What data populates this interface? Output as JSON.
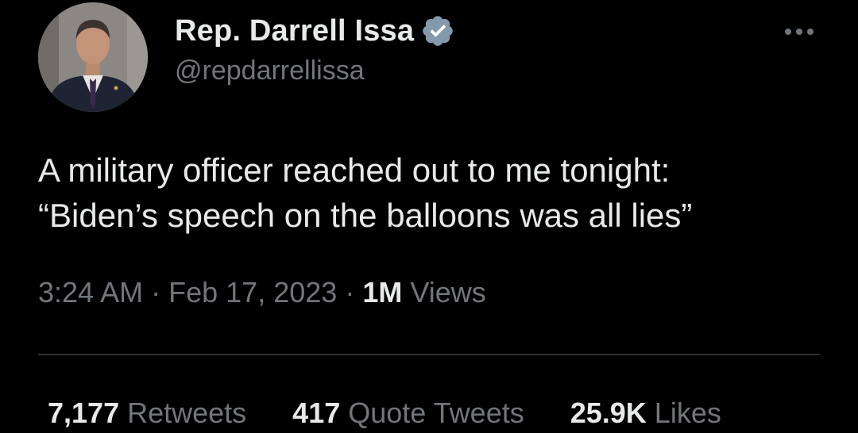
{
  "author": {
    "display_name": "Rep. Darrell Issa",
    "handle": "@repdarrellissa",
    "verified_icon": "verified-badge-icon",
    "verified_color": "#829aab"
  },
  "tweet": {
    "text_line1": "A military officer reached out to me tonight:",
    "text_line2": "“Biden’s speech on the balloons was all lies”"
  },
  "meta": {
    "time": "3:24 AM",
    "separator": "·",
    "date": "Feb 17, 2023",
    "views_count": "1M",
    "views_label": "Views"
  },
  "stats": {
    "retweets_count": "7,177",
    "retweets_label": "Retweets",
    "quotes_count": "417",
    "quotes_label": "Quote Tweets",
    "likes_count": "25.9K",
    "likes_label": "Likes"
  },
  "colors": {
    "background": "#000000",
    "primary_text": "#e7e9ea",
    "secondary_text": "#71767b",
    "divider": "#2f3336"
  },
  "icons": {
    "more": "more-options-icon",
    "avatar": "profile-avatar"
  }
}
